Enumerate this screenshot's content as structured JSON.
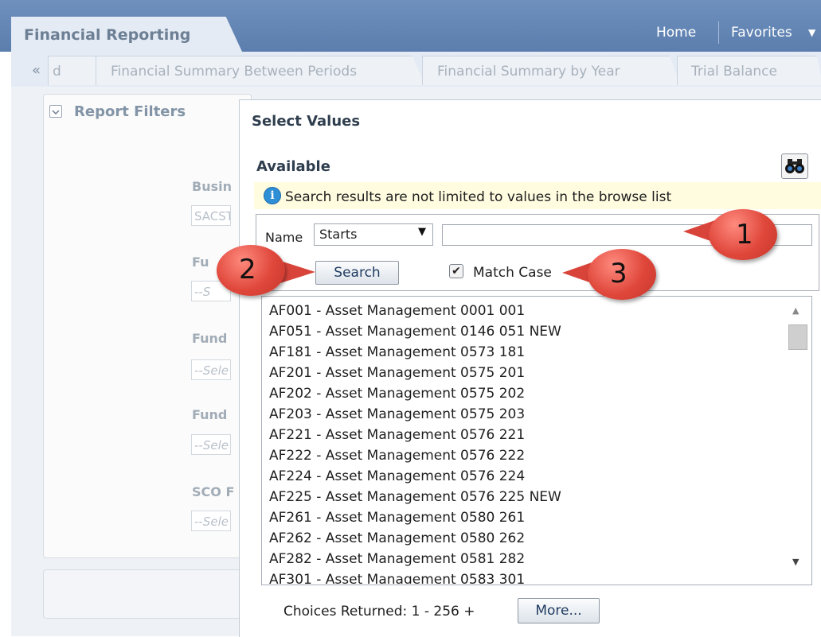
{
  "app": {
    "title": "Financial Reporting"
  },
  "header": {
    "home": "Home",
    "favorites": "Favorites"
  },
  "tabs": [
    {
      "label": "d"
    },
    {
      "label": "Financial Summary Between Periods"
    },
    {
      "label": "Financial Summary by Year"
    },
    {
      "label": "Trial Balance"
    }
  ],
  "filters": {
    "title": "Report Filters",
    "fields": [
      {
        "label": "Busin",
        "value": "SACST"
      },
      {
        "label": "Fu",
        "value": "--S"
      },
      {
        "label": "Fund",
        "value": "--Sele"
      },
      {
        "label": "Fund",
        "value": "--Sele"
      },
      {
        "label": "SCO F",
        "value": "--Sele"
      }
    ]
  },
  "dialog": {
    "title": "Select Values",
    "available_title": "Available",
    "info": "Search results are not limited to values in the browse list",
    "name_label": "Name",
    "operator": "Starts",
    "search_value": "",
    "search_button": "Search",
    "match_case": {
      "label": "Match Case",
      "checked": true
    },
    "values": [
      "AF001 - Asset Management 0001 001",
      "AF051 - Asset Management 0146 051 NEW",
      "AF181 - Asset Management 0573 181",
      "AF201 - Asset Management 0575 201",
      "AF202 - Asset Management 0575 202",
      "AF203 - Asset Management 0575 203",
      "AF221 - Asset Management 0576 221",
      "AF222 - Asset Management 0576 222",
      "AF224 - Asset Management 0576 224",
      "AF225 - Asset Management 0576 225 NEW",
      "AF261 - Asset Management 0580 261",
      "AF262 - Asset Management 0580 262",
      "AF282 - Asset Management 0581 282",
      "AF301 - Asset Management 0583 301"
    ],
    "choices_returned": "Choices Returned: 1 - 256 +",
    "more_button": "More..."
  },
  "callouts": [
    "1",
    "2",
    "3"
  ],
  "icons": {
    "collapse": "double-chevron-left-icon",
    "binoculars": "binoculars-icon",
    "info": "info-icon"
  },
  "colors": {
    "header": "#5b7eae",
    "callout": "#e0473b",
    "info_bg": "#fffce0"
  }
}
